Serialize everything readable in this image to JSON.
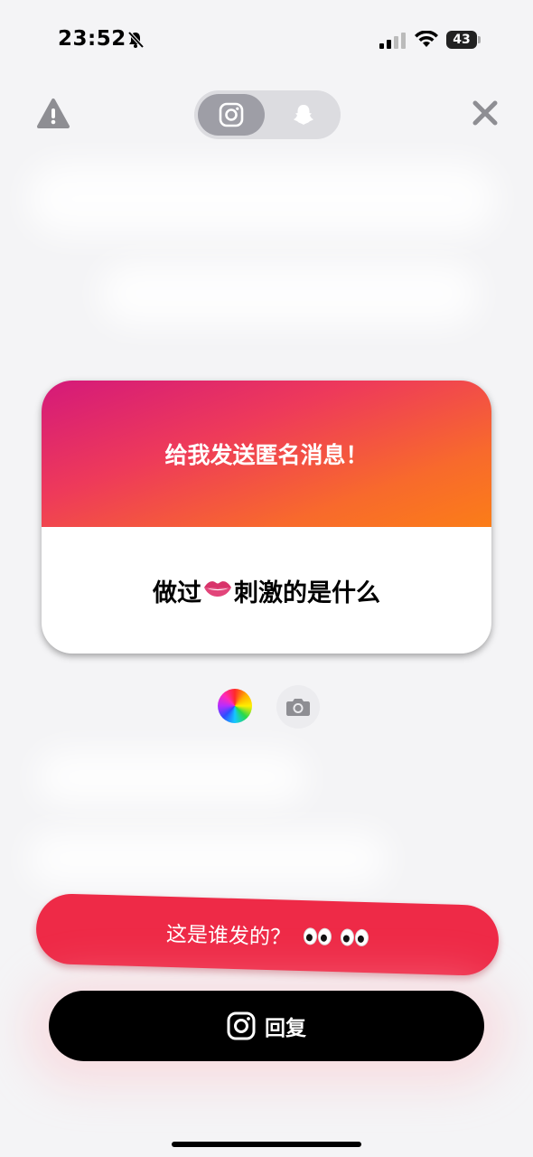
{
  "status_bar": {
    "time": "23:52",
    "battery_level": "43",
    "icons": [
      "bell-slash-icon",
      "cellular-signal-icon",
      "wifi-icon",
      "battery-icon"
    ]
  },
  "top_bar": {
    "warning_icon": "warning-icon",
    "close_icon": "close-icon",
    "platform_toggle": {
      "options": [
        "instagram-icon",
        "snapchat-icon"
      ],
      "selected": "instagram-icon"
    }
  },
  "card": {
    "header_text": "给我发送匿名消息！",
    "message_before": "做过",
    "message_emoji": "lips-icon",
    "message_after": "刺激的是什么",
    "colors": {
      "gradient_start": "#d4197a",
      "gradient_end": "#fb7d18"
    }
  },
  "tools": {
    "color_picker_icon": "color-wheel-icon",
    "camera_icon": "camera-icon"
  },
  "buttons": {
    "who_sent_label": "这是谁发的？",
    "who_sent_emoji": "eyes-icon",
    "reply_label": "回复"
  },
  "colors": {
    "accent_red": "#ee2a47",
    "reply_bg": "#000000",
    "background": "#f4f4f6"
  }
}
